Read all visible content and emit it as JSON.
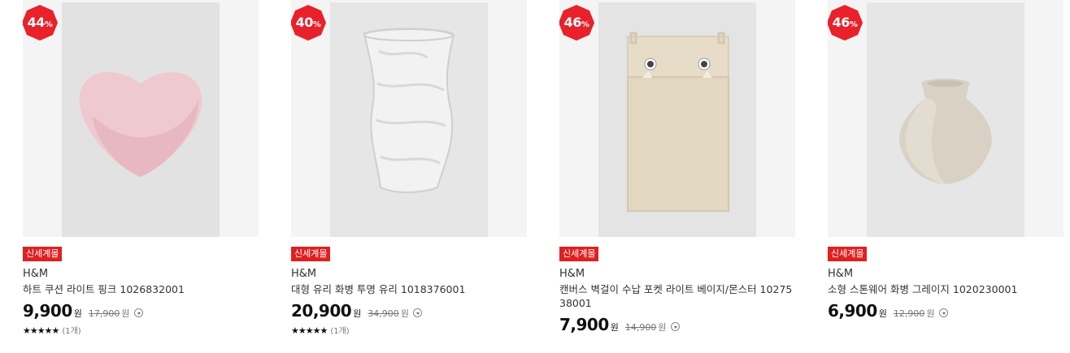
{
  "products": [
    {
      "discount": "44",
      "percent": "%",
      "tag": "신세계몰",
      "brand": "H&M",
      "name": "하트 쿠션 라이트 핑크 1026832001",
      "price": "9,900",
      "currency": "원",
      "original_price": "17,900",
      "stars": "★★★★★",
      "review_count": "(1개)",
      "image": "pink-heart-cushion"
    },
    {
      "discount": "40",
      "percent": "%",
      "tag": "신세계몰",
      "brand": "H&M",
      "name": "대형 유리 화병 투명 유리 1018376001",
      "price": "20,900",
      "currency": "원",
      "original_price": "34,900",
      "stars": "★★★★★",
      "review_count": "(1개)",
      "image": "clear-glass-vase"
    },
    {
      "discount": "46",
      "percent": "%",
      "tag": "신세계몰",
      "brand": "H&M",
      "name": "캔버스 벽걸이 수납 포켓 라이트 베이지/몬스터 1027538001",
      "price": "7,900",
      "currency": "원",
      "original_price": "14,900",
      "image": "beige-canvas-wall-pocket"
    },
    {
      "discount": "46",
      "percent": "%",
      "tag": "신세계몰",
      "brand": "H&M",
      "name": "소형 스톤웨어 화병 그레이지 1020230001",
      "price": "6,900",
      "currency": "원",
      "original_price": "12,900",
      "image": "greige-stoneware-vase"
    }
  ],
  "colors": {
    "badge": "#e8212a",
    "tag": "#e02020"
  }
}
